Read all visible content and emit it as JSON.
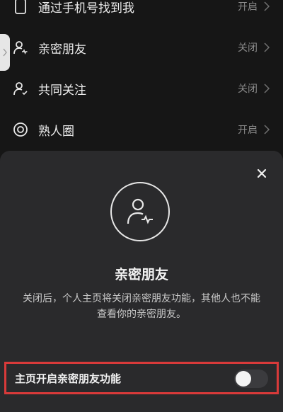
{
  "settings": {
    "items": [
      {
        "label": "通过手机号找到我",
        "status": "开启"
      },
      {
        "label": "亲密朋友",
        "status": "关闭"
      },
      {
        "label": "共同关注",
        "status": "关闭"
      },
      {
        "label": "熟人圈",
        "status": "开启"
      }
    ]
  },
  "sheet": {
    "title": "亲密朋友",
    "description": "关闭后，个人主页将关闭亲密朋友功能，其他人也不能查看你的亲密朋友。",
    "toggle_label": "主页开启亲密朋友功能",
    "toggle_on": false
  },
  "colors": {
    "background": "#161616",
    "sheet": "#2a2a2c",
    "highlight": "#d93a3a"
  }
}
